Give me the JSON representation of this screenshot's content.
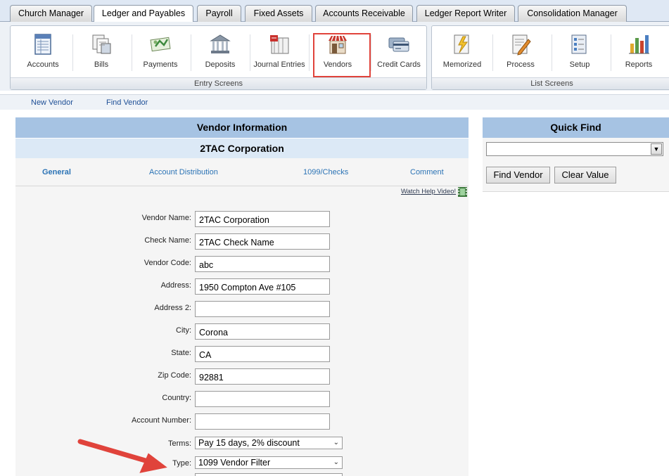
{
  "tabs": [
    "Church Manager",
    "Ledger and Payables",
    "Payroll",
    "Fixed Assets",
    "Accounts Receivable",
    "Ledger Report Writer",
    "Consolidation Manager"
  ],
  "toolbar": {
    "entry": {
      "title": "Entry Screens",
      "items": [
        {
          "label": "Accounts",
          "icon": "accounts-icon"
        },
        {
          "label": "Bills",
          "icon": "bills-icon"
        },
        {
          "label": "Payments",
          "icon": "payments-icon"
        },
        {
          "label": "Deposits",
          "icon": "deposits-icon"
        },
        {
          "label": "Journal Entries",
          "icon": "journal-entries-icon"
        },
        {
          "label": "Vendors",
          "icon": "vendors-icon"
        },
        {
          "label": "Credit Cards",
          "icon": "credit-cards-icon"
        }
      ]
    },
    "list": {
      "title": "List Screens",
      "items": [
        {
          "label": "Memorized",
          "icon": "memorized-icon"
        },
        {
          "label": "Process",
          "icon": "process-icon"
        },
        {
          "label": "Setup",
          "icon": "setup-icon"
        },
        {
          "label": "Reports",
          "icon": "reports-icon"
        }
      ]
    }
  },
  "links": {
    "new_vendor": "New Vendor",
    "find_vendor": "Find Vendor"
  },
  "vendor": {
    "header": "Vendor Information",
    "name_banner": "2TAC Corporation",
    "subtabs": [
      "General",
      "Account Distribution",
      "1099/Checks",
      "Comment"
    ],
    "help_link": "Watch Help Video!",
    "fields": [
      {
        "label": "Vendor Name:",
        "value": "2TAC Corporation"
      },
      {
        "label": "Check Name:",
        "value": "2TAC Check Name"
      },
      {
        "label": "Vendor Code:",
        "value": "abc"
      },
      {
        "label": "Address:",
        "value": "1950 Compton Ave #105"
      },
      {
        "label": "Address 2:",
        "value": ""
      },
      {
        "label": "City:",
        "value": "Corona"
      },
      {
        "label": "State:",
        "value": "CA"
      },
      {
        "label": "Zip Code:",
        "value": "92881"
      },
      {
        "label": "Country:",
        "value": ""
      },
      {
        "label": "Account Number:",
        "value": ""
      }
    ],
    "terms": {
      "label": "Terms:",
      "value": "Pay 15 days, 2% discount"
    },
    "type": {
      "label": "Type:",
      "value": "1099 Vendor Filter"
    }
  },
  "quickfind": {
    "title": "Quick Find",
    "select_value": "",
    "find_button": "Find Vendor",
    "clear_button": "Clear Value"
  },
  "colors": {
    "highlight": "#e0433b",
    "header": "#a6c3e3",
    "link": "#2b73b5"
  }
}
